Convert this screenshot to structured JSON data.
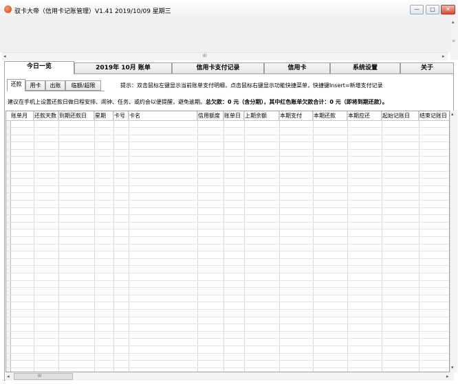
{
  "window": {
    "title": "驭卡大帝（信用卡记账管理）V1.41     2019/10/09  星期三",
    "buttons": {
      "minimize": "—",
      "maximize": "□",
      "close": "✕"
    }
  },
  "main_tabs": [
    {
      "label": "今日一览",
      "active": true
    },
    {
      "label": "2019年 10月 账单",
      "active": false
    },
    {
      "label": "信用卡支付记录",
      "active": false
    },
    {
      "label": "信用卡",
      "active": false
    },
    {
      "label": "系统设置",
      "active": false
    },
    {
      "label": "关于",
      "active": false
    }
  ],
  "sub_tabs": [
    {
      "label": "还款",
      "active": true
    },
    {
      "label": "用卡",
      "active": false
    },
    {
      "label": "出账",
      "active": false
    },
    {
      "label": "临额/超限",
      "active": false
    }
  ],
  "hint": "提示：双击鼠标左键显示当前账单支付明细，点击鼠标右键显示功能快捷菜单，快捷键Insert=新增支付记录",
  "warning": {
    "prefix": "建议在手机上设置还款日做日程安排、闹钟、任务、或约会以便提醒，避免逾期。",
    "summary": "总欠款：0 元（含分期），其中红色账单欠款合计：0 元（即将到期还款）。"
  },
  "table": {
    "columns": [
      "账单月",
      "还款天数",
      "到期还款日",
      "星期",
      "卡号",
      "卡名",
      "信用额度",
      "账单日",
      "上期余额",
      "本期支付",
      "本期还款",
      "本期应还",
      "起始记账日",
      "结束记账日"
    ],
    "rows": []
  },
  "scrollbars": {
    "h_top_mark": "III",
    "h_bottom_mark": "III"
  }
}
